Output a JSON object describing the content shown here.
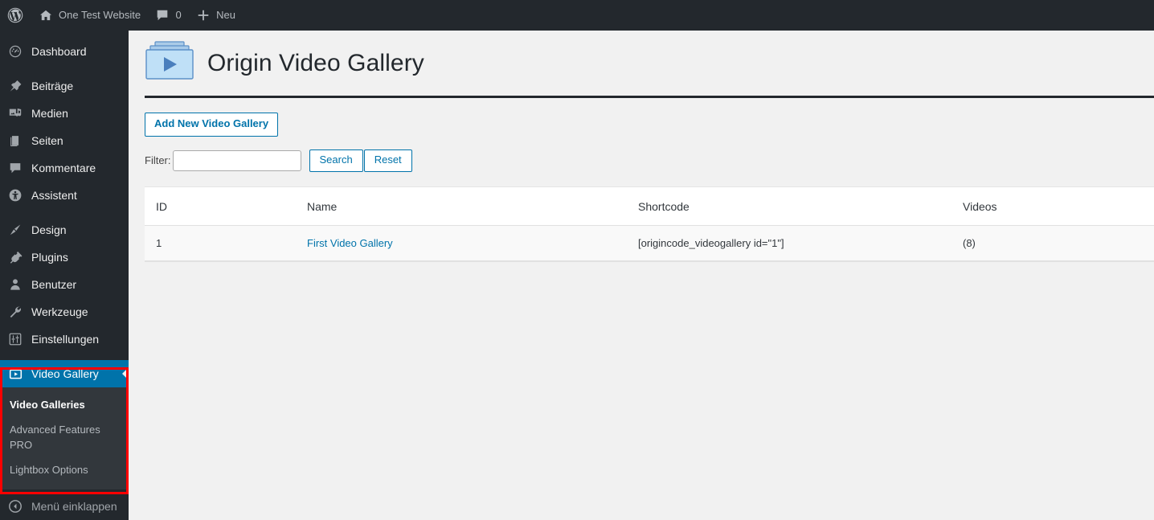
{
  "adminbar": {
    "wp_logo_icon": "wordpress-logo-icon",
    "site_name": "One Test Website",
    "home_icon": "home-icon",
    "comments_icon": "comment-bubble-icon",
    "comments_count": "0",
    "new_icon": "plus-icon",
    "new_label": "Neu"
  },
  "sidebar": {
    "items": [
      {
        "label": "Dashboard",
        "icon": "dashboard-gauge-icon"
      },
      {
        "label": "Beiträge",
        "icon": "pin-icon"
      },
      {
        "label": "Medien",
        "icon": "media-icon"
      },
      {
        "label": "Seiten",
        "icon": "pages-icon"
      },
      {
        "label": "Kommentare",
        "icon": "comment-bubble-icon"
      },
      {
        "label": "Assistent",
        "icon": "accessibility-icon"
      },
      {
        "label": "Design",
        "icon": "paintbrush-icon"
      },
      {
        "label": "Plugins",
        "icon": "plug-icon"
      },
      {
        "label": "Benutzer",
        "icon": "user-icon"
      },
      {
        "label": "Werkzeuge",
        "icon": "wrench-icon"
      },
      {
        "label": "Einstellungen",
        "icon": "sliders-icon"
      }
    ],
    "active_item": {
      "label": "Video Gallery",
      "icon": "video-play-box-icon"
    },
    "submenu": [
      {
        "label": "Video Galleries",
        "current": true
      },
      {
        "label": "Advanced Features PRO",
        "current": false
      },
      {
        "label": "Lightbox Options",
        "current": false
      }
    ],
    "collapse": {
      "label": "Menü einklappen",
      "icon": "collapse-arrow-icon"
    },
    "active_color": "#0073aa",
    "annotation_color": "#ff0000"
  },
  "page": {
    "logo_icon": "video-gallery-logo-icon",
    "title": "Origin Video Gallery",
    "add_new_label": "Add New Video Gallery",
    "filter_label": "Filter:",
    "filter_value": "",
    "filter_placeholder": "",
    "search_label": "Search",
    "reset_label": "Reset"
  },
  "table": {
    "columns": [
      "ID",
      "Name",
      "Shortcode",
      "Videos"
    ],
    "rows": [
      {
        "id": "1",
        "name": "First Video Gallery",
        "shortcode": "[origincode_videogallery id=\"1\"]",
        "videos": "(8)"
      }
    ]
  }
}
